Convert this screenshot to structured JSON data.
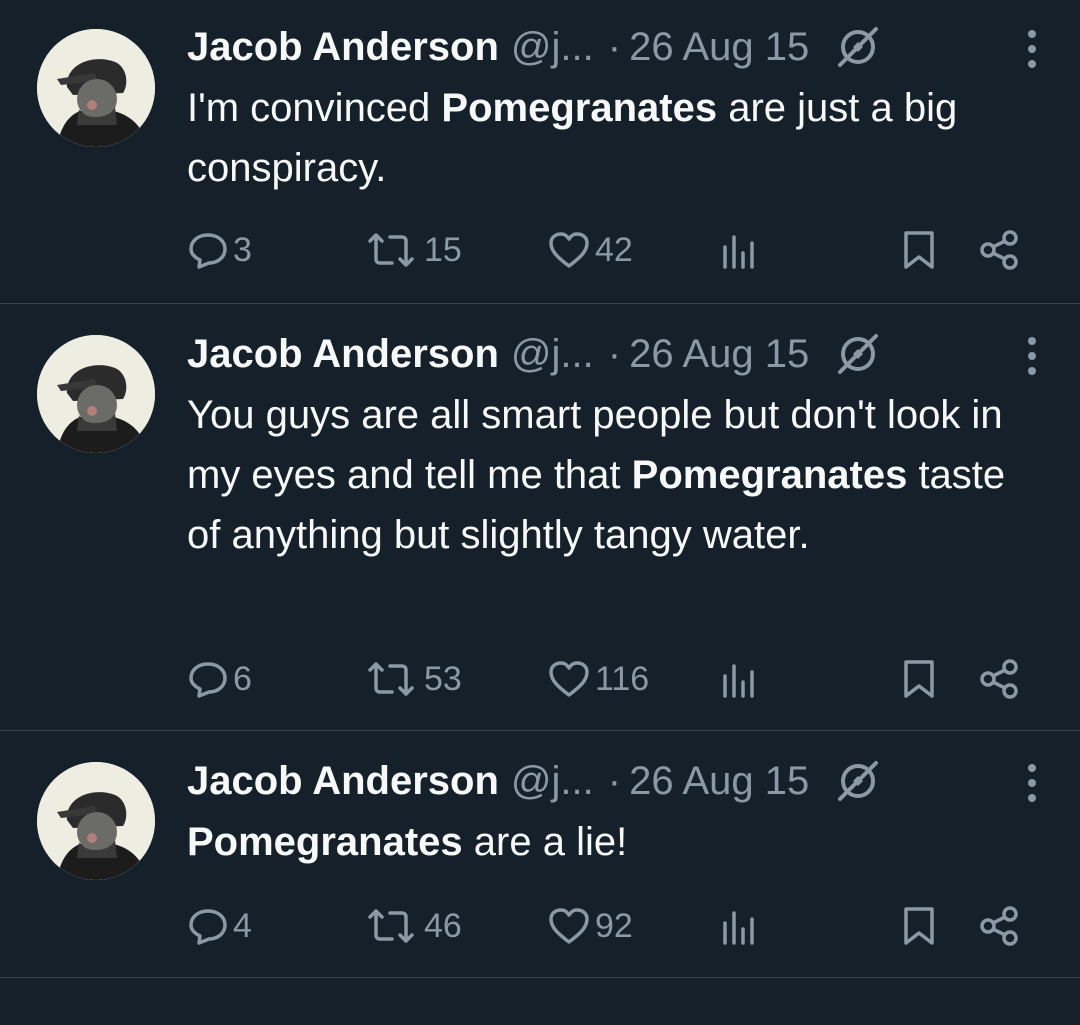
{
  "colors": {
    "background": "#15202b",
    "primary_text": "#f7f9f9",
    "secondary_text": "#8b98a5",
    "divider": "#38444d"
  },
  "tweets": [
    {
      "author_name": "Jacob Anderson",
      "handle": "@j...",
      "separator": "·",
      "date": "26 Aug 15",
      "text_segments": [
        {
          "text": "I'm convinced ",
          "bold": false
        },
        {
          "text": "Pomegranates",
          "bold": true
        },
        {
          "text": " are just a big conspiracy.",
          "bold": false
        }
      ],
      "replies": "3",
      "retweets": "15",
      "likes": "42"
    },
    {
      "author_name": "Jacob Anderson",
      "handle": "@j...",
      "separator": "·",
      "date": "26 Aug 15",
      "text_segments": [
        {
          "text": "You guys are all smart people but don't look in my eyes and tell me that ",
          "bold": false
        },
        {
          "text": "Pomegranates",
          "bold": true
        },
        {
          "text": " taste of anything but slightly tangy water.",
          "bold": false
        }
      ],
      "replies": "6",
      "retweets": "53",
      "likes": "116"
    },
    {
      "author_name": "Jacob Anderson",
      "handle": "@j...",
      "separator": "·",
      "date": "26 Aug 15",
      "text_segments": [
        {
          "text": "Pomegranates",
          "bold": true
        },
        {
          "text": " are a lie!",
          "bold": false
        }
      ],
      "replies": "4",
      "retweets": "46",
      "likes": "92"
    }
  ],
  "icons": {
    "reply": "reply-icon",
    "retweet": "retweet-icon",
    "like": "heart-icon",
    "views": "views-icon",
    "bookmark": "bookmark-icon",
    "share": "share-icon",
    "verified": "unverified-slash-icon",
    "more": "more-icon"
  }
}
